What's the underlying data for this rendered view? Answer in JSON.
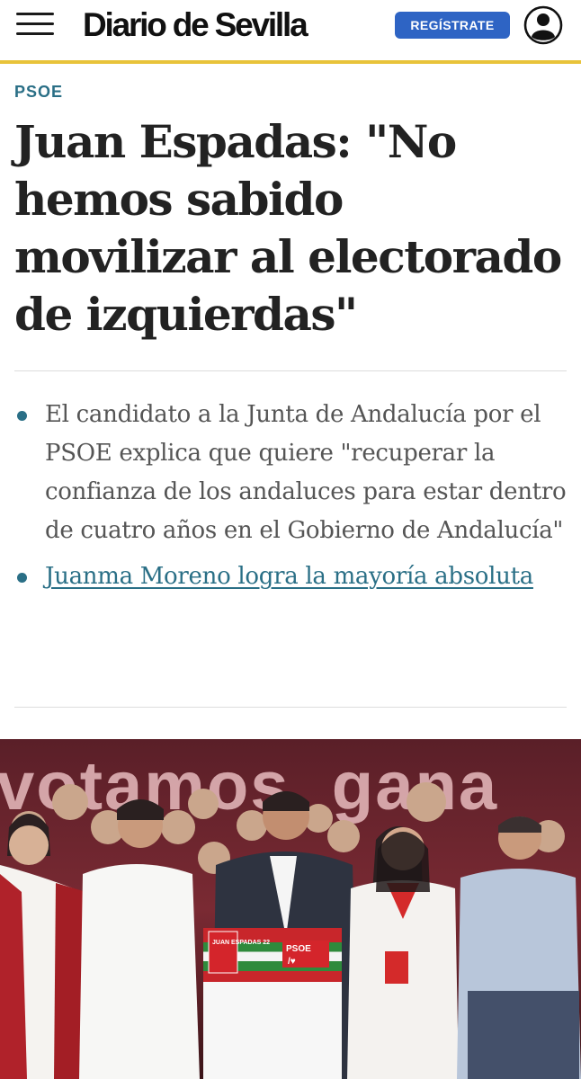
{
  "header": {
    "logo_text": "Diario de Sevilla",
    "register_label": "REGÍSTRATE",
    "menu_icon": "hamburger-menu-icon",
    "user_icon": "user-account-icon",
    "accent_color": "#e8c33a",
    "button_color": "#2e64c4"
  },
  "article": {
    "section": "PSOE",
    "headline": "Juan Espadas: \"No hemos sabido movilizar al electorado de izquierdas\"",
    "summary": [
      {
        "text": "El candidato a la Junta de Andalucía por el PSOE explica que quiere \"recuperar la confianza de los andaluces para estar dentro de cuatro años en el Gobierno de Andalucía\""
      },
      {
        "text": "Juanma Moreno logra la mayoría absoluta",
        "is_link": true
      }
    ],
    "link_color": "#2a6f86"
  },
  "photo": {
    "backdrop_text": "votamos, gana",
    "lectern_text": "JUAN ESPADAS 22",
    "lectern_logo": "PSOE",
    "lectern_heart": "/♥"
  }
}
